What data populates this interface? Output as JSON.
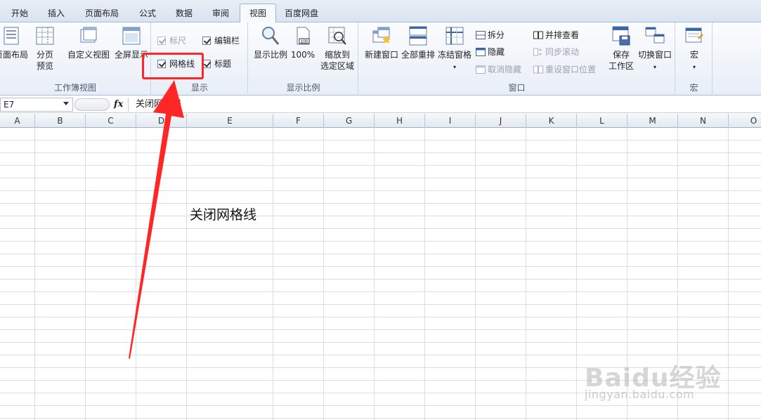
{
  "tabs": [
    {
      "label": "开始",
      "active": false
    },
    {
      "label": "插入",
      "active": false
    },
    {
      "label": "页面布局",
      "active": false
    },
    {
      "label": "公式",
      "active": false
    },
    {
      "label": "数据",
      "active": false
    },
    {
      "label": "审阅",
      "active": false
    },
    {
      "label": "视图",
      "active": true
    },
    {
      "label": "百度网盘",
      "active": false
    }
  ],
  "ribbon": {
    "workbook_views": {
      "label": "工作簿视图",
      "page_layout": "页面布局",
      "page_break_line1": "分页",
      "page_break_line2": "预览",
      "custom_view": "自定义视图",
      "full_screen": "全屏显示"
    },
    "show": {
      "label": "显示",
      "ruler": {
        "label": "标尺",
        "checked": true,
        "disabled": true
      },
      "formula_bar": {
        "label": "编辑栏",
        "checked": true,
        "disabled": false
      },
      "gridlines": {
        "label": "网格线",
        "checked": true,
        "disabled": false
      },
      "headings": {
        "label": "标题",
        "checked": true,
        "disabled": false
      }
    },
    "zoom": {
      "label": "显示比例",
      "zoom": "显示比例",
      "hundred": "100%",
      "hundred_icon_text": "100",
      "zoom_selection_line1": "缩放到",
      "zoom_selection_line2": "选定区域"
    },
    "window": {
      "label": "窗口",
      "new_window": "新建窗口",
      "arrange_all": "全部重排",
      "freeze_panes": "冻结窗格",
      "split": "拆分",
      "hide": "隐藏",
      "unhide": "取消隐藏",
      "side_by_side": "并排查看",
      "sync_scroll": "同步滚动",
      "reset_position": "重设窗口位置",
      "save_workspace_line1": "保存",
      "save_workspace_line2": "工作区",
      "switch_windows": "切换窗口"
    },
    "macros": {
      "label": "宏",
      "macros": "宏"
    }
  },
  "formula_bar": {
    "name_box": "E7",
    "fx": "fx",
    "content": "关闭网格线"
  },
  "grid": {
    "columns": [
      "A",
      "B",
      "C",
      "D",
      "E",
      "F",
      "G",
      "H",
      "I",
      "J",
      "K",
      "L",
      "M",
      "N",
      "O"
    ],
    "cell_E7": "关闭网格线"
  },
  "watermark": {
    "logo": "Baidu经验",
    "url": "jingyan.baidu.com"
  },
  "colors": {
    "annotation_red": "#ff2626",
    "gridline": "#d9dee6",
    "ribbon_border": "#a9bcd6"
  }
}
